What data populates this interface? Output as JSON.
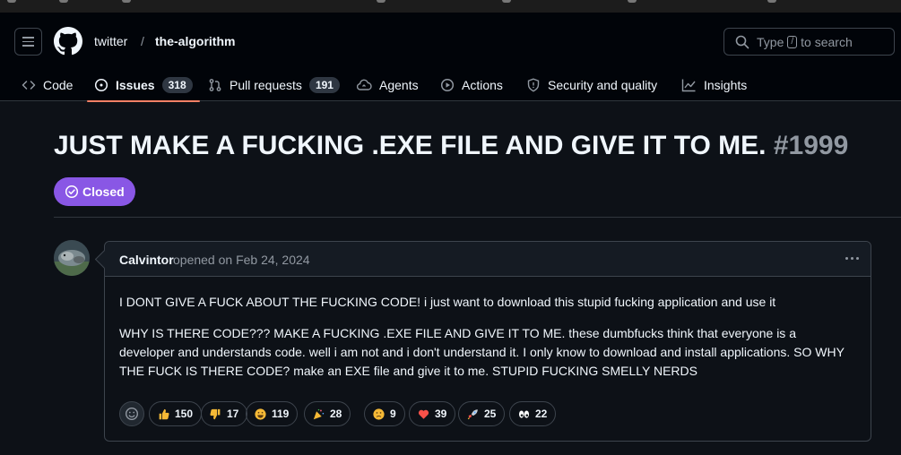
{
  "repo": {
    "owner": "twitter",
    "separator": "/",
    "name": "the-algorithm"
  },
  "search": {
    "prefix": "Type",
    "key": "/",
    "suffix": "to search"
  },
  "nav": [
    {
      "label": "Code",
      "icon": "code-icon"
    },
    {
      "label": "Issues",
      "icon": "issue-opened-icon",
      "count": "318",
      "selected": true
    },
    {
      "label": "Pull requests",
      "icon": "git-pull-request-icon",
      "count": "191"
    },
    {
      "label": "Agents",
      "icon": "agent-icon"
    },
    {
      "label": "Actions",
      "icon": "play-icon"
    },
    {
      "label": "Security and quality",
      "icon": "shield-icon"
    },
    {
      "label": "Insights",
      "icon": "graph-icon"
    }
  ],
  "issue": {
    "title": "JUST MAKE A FUCKING .EXE FILE AND GIVE IT TO ME.",
    "number": "#1999",
    "state": "Closed",
    "state_color": "#8957e5"
  },
  "comment": {
    "author": "Calvintor",
    "meta": "opened on Feb 24, 2024",
    "paragraphs": [
      "I DONT GIVE A FUCK ABOUT THE FUCKING CODE! i just want to download this stupid fucking application and use it",
      "WHY IS THERE CODE??? MAKE A FUCKING .EXE FILE AND GIVE IT TO ME. these dumbfucks think that everyone is a developer and understands code. well i am not and i don't understand it. I only know to download and install applications. SO WHY THE FUCK IS THERE CODE? make an EXE file and give it to me. STUPID FUCKING SMELLY NERDS"
    ]
  },
  "reactions": [
    {
      "icon": "thumbs-up-icon",
      "count": "150"
    },
    {
      "icon": "thumbs-down-icon",
      "count": "17"
    },
    {
      "icon": "laugh-icon",
      "count": "119"
    },
    {
      "icon": "hooray-icon",
      "count": "28"
    },
    {
      "icon": "confused-icon",
      "count": "9"
    },
    {
      "icon": "heart-icon",
      "count": "39"
    },
    {
      "icon": "rocket-icon",
      "count": "25"
    },
    {
      "icon": "eyes-icon",
      "count": "22"
    }
  ],
  "colors": {
    "accent_underline": "#f78166",
    "background": "#0d1117",
    "header": "#010409"
  }
}
